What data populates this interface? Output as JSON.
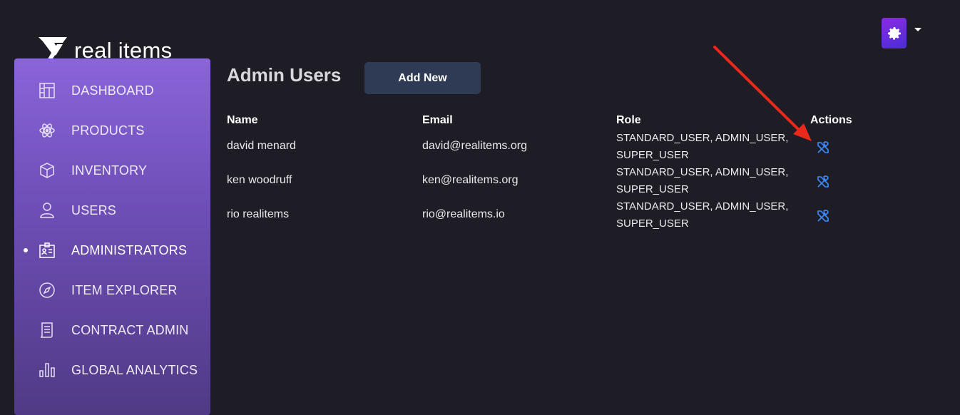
{
  "brand": {
    "name": "real items"
  },
  "header": {
    "settings_icon": "gear-icon",
    "settings_color": "#8a2be2"
  },
  "sidebar": {
    "items": [
      {
        "label": "DASHBOARD",
        "icon": "dashboard-icon",
        "active": false
      },
      {
        "label": "PRODUCTS",
        "icon": "atom-icon",
        "active": false
      },
      {
        "label": "INVENTORY",
        "icon": "box-icon",
        "active": false
      },
      {
        "label": "USERS",
        "icon": "user-icon",
        "active": false
      },
      {
        "label": "ADMINISTRATORS",
        "icon": "id-card-icon",
        "active": true
      },
      {
        "label": "ITEM EXPLORER",
        "icon": "compass-icon",
        "active": false
      },
      {
        "label": "CONTRACT ADMIN",
        "icon": "scroll-icon",
        "active": false
      },
      {
        "label": "GLOBAL ANALYTICS",
        "icon": "bar-chart-icon",
        "active": false
      }
    ]
  },
  "main": {
    "title": "Admin Users",
    "add_button": "Add New",
    "table": {
      "headers": {
        "name": "Name",
        "email": "Email",
        "role": "Role",
        "actions": "Actions"
      },
      "rows": [
        {
          "name": "david menard",
          "email": "david@realitems.org",
          "role_line1": "STANDARD_USER, ADMIN_USER,",
          "role_line2": "SUPER_USER",
          "action_icon": "tools-icon"
        },
        {
          "name": "ken woodruff",
          "email": "ken@realitems.org",
          "role_line1": "STANDARD_USER, ADMIN_USER,",
          "role_line2": "SUPER_USER",
          "action_icon": "tools-icon"
        },
        {
          "name": "rio realitems",
          "email": "rio@realitems.io",
          "role_line1": "STANDARD_USER, ADMIN_USER,",
          "role_line2": "SUPER_USER",
          "action_icon": "tools-icon"
        }
      ]
    }
  },
  "colors": {
    "background": "#1e1d26",
    "action_icon": "#3d8bfd",
    "annotation": "#e8291c"
  }
}
